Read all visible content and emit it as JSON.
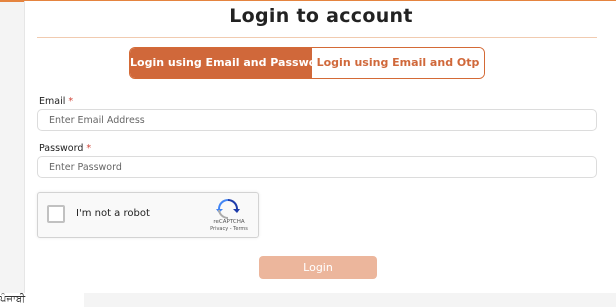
{
  "page": {
    "title": "Login to account"
  },
  "tabs": [
    {
      "label": "Login using Email and Password",
      "active": true
    },
    {
      "label": "Login using Email and Otp",
      "active": false
    }
  ],
  "form": {
    "email": {
      "label": "Email",
      "required_mark": "*",
      "placeholder": "Enter Email Address",
      "value": ""
    },
    "password": {
      "label": "Password",
      "required_mark": "*",
      "placeholder": "Enter Password",
      "value": ""
    }
  },
  "captcha": {
    "label": "I'm not a robot",
    "brand": "reCAPTCHA",
    "terms": "Privacy - Terms",
    "icon": "recaptcha-icon"
  },
  "submit": {
    "label": "Login"
  },
  "fragment": {
    "text": "ਪੰਜਾਬੀ"
  },
  "colors": {
    "accent": "#d0683a",
    "button_disabled": "#ecb69c",
    "required": "#d0463a"
  }
}
